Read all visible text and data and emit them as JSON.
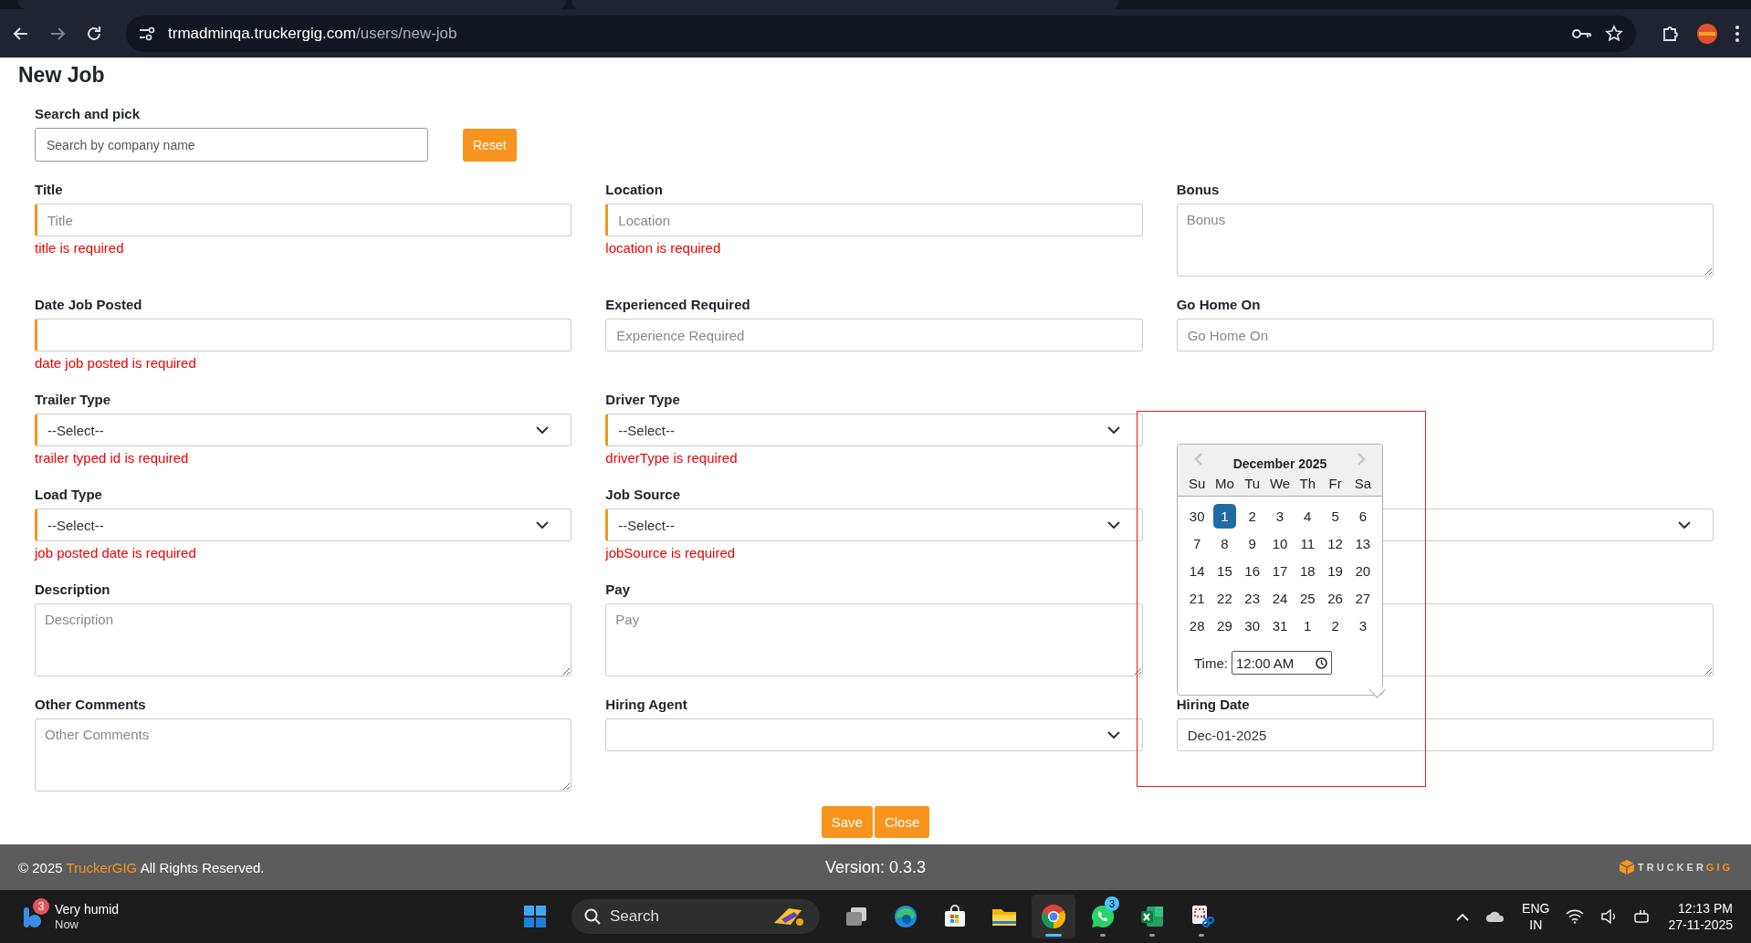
{
  "browser": {
    "url_host": "trmadminqa.truckergig.com",
    "url_path": "/users/new-job"
  },
  "page_title": "New Job",
  "search": {
    "label": "Search and pick",
    "placeholder": "Search by company name",
    "button": "Reset"
  },
  "fields": [
    {
      "kind": "text",
      "label": "Title",
      "placeholder": "Title",
      "required": true,
      "error": "title is required"
    },
    {
      "kind": "text",
      "label": "Location",
      "placeholder": "Location",
      "required": true,
      "error": "location is required"
    },
    {
      "kind": "textarea",
      "label": "Bonus",
      "placeholder": "Bonus",
      "required": false
    },
    {
      "kind": "text",
      "label": "Date Job Posted",
      "required": true,
      "error": "date job posted is required"
    },
    {
      "kind": "text",
      "label": "Experienced Required",
      "placeholder": "Experience Required",
      "required": false
    },
    {
      "kind": "text",
      "label": "Go Home On",
      "placeholder": "Go Home On",
      "required": false
    },
    {
      "kind": "select",
      "label": "Trailer Type",
      "value": "--Select--",
      "required": true,
      "error": "trailer typed id is required"
    },
    {
      "kind": "select",
      "label": "Driver Type",
      "value": "--Select--",
      "required": true,
      "error": "driverType is required"
    },
    {
      "kind": "empty"
    },
    {
      "kind": "select",
      "label": "Load Type",
      "value": "--Select--",
      "required": true,
      "error": "job posted date is required"
    },
    {
      "kind": "select",
      "label": "Job Source",
      "value": "--Select--",
      "required": true,
      "error": "jobSource is required"
    },
    {
      "kind": "select"
    },
    {
      "kind": "textarea",
      "label": "Description",
      "placeholder": "Description",
      "required": false
    },
    {
      "kind": "textarea",
      "label": "Pay",
      "placeholder": "Pay",
      "required": false
    },
    {
      "kind": "textarea"
    },
    {
      "kind": "textarea",
      "label": "Other Comments",
      "placeholder": "Other Comments",
      "required": false
    },
    {
      "kind": "select",
      "label": "Hiring Agent",
      "required": false
    },
    {
      "kind": "text",
      "label": "Hiring Date",
      "value": "Dec-01-2025",
      "required": false
    }
  ],
  "datepicker": {
    "month": "December 2025",
    "weekdays": [
      "Su",
      "Mo",
      "Tu",
      "We",
      "Th",
      "Fr",
      "Sa"
    ],
    "weeks": [
      [
        {
          "day": "30",
          "selected": false
        },
        {
          "day": "1",
          "selected": true
        },
        {
          "day": "2",
          "selected": false
        },
        {
          "day": "3",
          "selected": false
        },
        {
          "day": "4",
          "selected": false
        },
        {
          "day": "5",
          "selected": false
        },
        {
          "day": "6",
          "selected": false
        }
      ],
      [
        {
          "day": "7",
          "selected": false
        },
        {
          "day": "8",
          "selected": false
        },
        {
          "day": "9",
          "selected": false
        },
        {
          "day": "10",
          "selected": false
        },
        {
          "day": "11",
          "selected": false
        },
        {
          "day": "12",
          "selected": false
        },
        {
          "day": "13",
          "selected": false
        }
      ],
      [
        {
          "day": "14",
          "selected": false
        },
        {
          "day": "15",
          "selected": false
        },
        {
          "day": "16",
          "selected": false
        },
        {
          "day": "17",
          "selected": false
        },
        {
          "day": "18",
          "selected": false
        },
        {
          "day": "19",
          "selected": false
        },
        {
          "day": "20",
          "selected": false
        }
      ],
      [
        {
          "day": "21",
          "selected": false
        },
        {
          "day": "22",
          "selected": false
        },
        {
          "day": "23",
          "selected": false
        },
        {
          "day": "24",
          "selected": false
        },
        {
          "day": "25",
          "selected": false
        },
        {
          "day": "26",
          "selected": false
        },
        {
          "day": "27",
          "selected": false
        }
      ],
      [
        {
          "day": "28",
          "selected": false
        },
        {
          "day": "29",
          "selected": false
        },
        {
          "day": "30",
          "selected": false
        },
        {
          "day": "31",
          "selected": false
        },
        {
          "day": "1",
          "selected": false
        },
        {
          "day": "2",
          "selected": false
        },
        {
          "day": "3",
          "selected": false
        }
      ]
    ],
    "time_label": "Time:",
    "time_value": "12:00 AM"
  },
  "actions": [
    "Save",
    "Close"
  ],
  "footer": {
    "copyright": "© 2025",
    "brand_link": "TruckerGIG",
    "rights": "All Rights Reserved.",
    "version": "Version: 0.3.3",
    "logo_part_1": "TRUCKER",
    "logo_part_2": "GIG"
  },
  "taskbar": {
    "weather": {
      "badge": "3",
      "title": "Very humid",
      "subtitle": "Now"
    },
    "search": "Search",
    "apps": [
      {
        "kind": "taskview",
        "running": false,
        "active": false
      },
      {
        "kind": "edge",
        "running": false,
        "active": false
      },
      {
        "kind": "store",
        "running": false,
        "active": false
      },
      {
        "kind": "files",
        "running": false,
        "active": false
      },
      {
        "kind": "chrome",
        "running": true,
        "active": true
      },
      {
        "kind": "whatsapp",
        "running": true,
        "active": false,
        "badge": "3"
      },
      {
        "kind": "excel",
        "running": true,
        "active": false
      },
      {
        "kind": "snip",
        "running": true,
        "active": false
      }
    ],
    "language": "ENG",
    "region": "IN",
    "time": "12:13 PM",
    "date": "27-11-2025"
  }
}
